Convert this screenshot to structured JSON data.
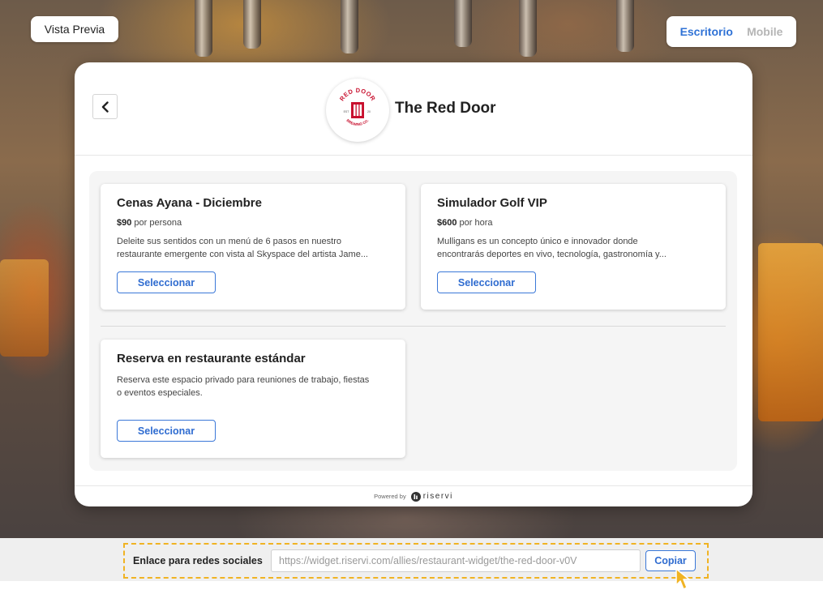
{
  "preview_label": "Vista Previa",
  "view_toggle": {
    "desktop": "Escritorio",
    "mobile": "Mobile"
  },
  "restaurant": {
    "name": "The Red Door",
    "logo_text_top": "RED DOOR",
    "logo_text_bottom": "BREWING CO.",
    "logo_left": "EST",
    "logo_right": "20"
  },
  "experiences": [
    {
      "title": "Cenas Ayana - Diciembre",
      "price": "$90",
      "price_unit": "por persona",
      "desc_line1": "Deleite sus sentidos con un menú de 6 pasos  en nuestro",
      "desc_line2": "restaurante emergente con vista al Skyspace del artista Jame...",
      "button": "Seleccionar"
    },
    {
      "title": "Simulador Golf VIP",
      "price": "$600",
      "price_unit": "por hora",
      "desc_line1": "Mulligans es un concepto único e innovador donde",
      "desc_line2": "encontrarás deportes en vivo, tecnología, gastronomía y...",
      "button": "Seleccionar"
    },
    {
      "title": "Reserva en restaurante estándar",
      "desc_line1": "Reserva este espacio privado para reuniones de trabajo, fiestas",
      "desc_line2": "o eventos especiales.",
      "button": "Seleccionar"
    }
  ],
  "footer": {
    "powered_by": "Powered by",
    "brand": "riservi"
  },
  "share": {
    "label": "Enlace para redes sociales",
    "url": "https://widget.riservi.com/allies/restaurant-widget/the-red-door-v0V",
    "copy_button": "Copiar"
  },
  "colors": {
    "accent": "#2f72d6",
    "highlight": "#f0b323",
    "logo_red": "#c8102e"
  }
}
